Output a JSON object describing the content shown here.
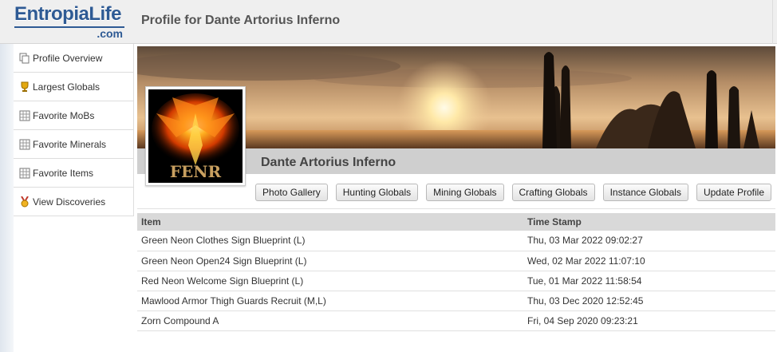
{
  "header": {
    "logo_main": "EntropiaLife",
    "logo_sub": ".com",
    "title": "Profile for Dante Artorius Inferno"
  },
  "sidebar": {
    "items": [
      {
        "label": "Profile Overview",
        "icon": "pages-icon"
      },
      {
        "label": "Largest Globals",
        "icon": "trophy-icon"
      },
      {
        "label": "Favorite MoBs",
        "icon": "grid-icon"
      },
      {
        "label": "Favorite Minerals",
        "icon": "grid-icon"
      },
      {
        "label": "Favorite Items",
        "icon": "grid-icon"
      },
      {
        "label": "View Discoveries",
        "icon": "medal-icon"
      }
    ]
  },
  "profile": {
    "name": "Dante Artorius Inferno",
    "avatar_text": "FENR"
  },
  "buttons": {
    "photo_gallery": "Photo Gallery",
    "hunting_globals": "Hunting Globals",
    "mining_globals": "Mining Globals",
    "crafting_globals": "Crafting Globals",
    "instance_globals": "Instance Globals",
    "update_profile": "Update Profile"
  },
  "table": {
    "headers": [
      "Item",
      "Time Stamp"
    ],
    "rows": [
      [
        "Green Neon Clothes Sign Blueprint (L)",
        "Thu, 03 Mar 2022 09:02:27"
      ],
      [
        "Green Neon Open24 Sign Blueprint (L)",
        "Wed, 02 Mar 2022 11:07:10"
      ],
      [
        "Red Neon Welcome Sign Blueprint (L)",
        "Tue, 01 Mar 2022 11:58:54"
      ],
      [
        "Mawlood Armor Thigh Guards Recruit (M,L)",
        "Thu, 03 Dec 2020 12:52:45"
      ],
      [
        "Zorn Compound A",
        "Fri, 04 Sep 2020 09:23:21"
      ]
    ]
  },
  "colors": {
    "brand": "#2e5a94",
    "header_bg": "#efefef",
    "namebar_bg": "#cfcfcf",
    "table_header_bg": "#d9d9d9"
  }
}
